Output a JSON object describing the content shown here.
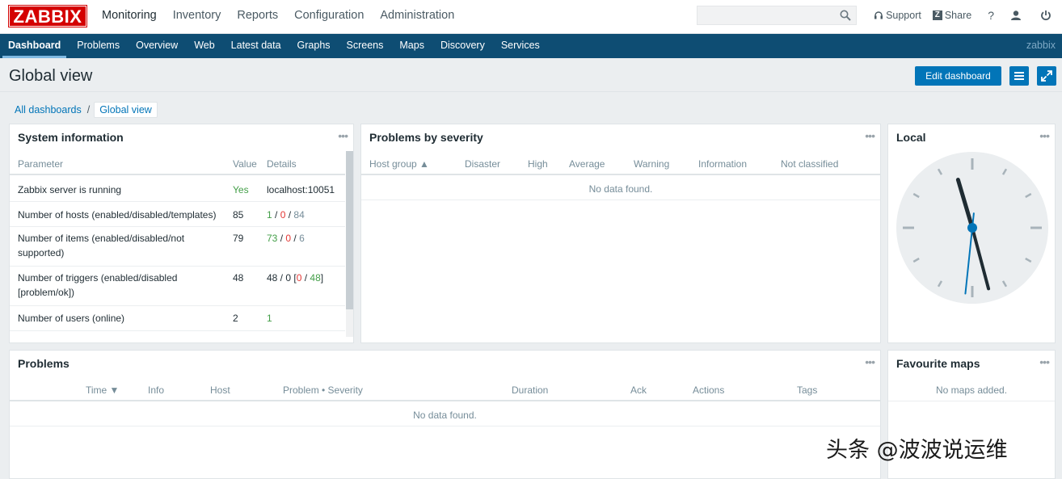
{
  "brand": {
    "logo_text": "ZABBIX",
    "accent": "#d40000",
    "nav_bg": "#0e4d73",
    "button_bg": "#0275b8"
  },
  "main_menu": [
    {
      "label": "Monitoring",
      "active": true
    },
    {
      "label": "Inventory"
    },
    {
      "label": "Reports"
    },
    {
      "label": "Configuration"
    },
    {
      "label": "Administration"
    }
  ],
  "search": {
    "value": "",
    "placeholder": "",
    "icon": "search-icon"
  },
  "top_links": {
    "support": "Support",
    "share": "Share",
    "help": "?",
    "share_icon_text": "Z"
  },
  "sub_menu": [
    {
      "label": "Dashboard",
      "active": true
    },
    {
      "label": "Problems"
    },
    {
      "label": "Overview"
    },
    {
      "label": "Web"
    },
    {
      "label": "Latest data"
    },
    {
      "label": "Graphs"
    },
    {
      "label": "Screens"
    },
    {
      "label": "Maps"
    },
    {
      "label": "Discovery"
    },
    {
      "label": "Services"
    }
  ],
  "user": "zabbix",
  "page": {
    "title": "Global view",
    "edit_button": "Edit dashboard",
    "breadcrumb": {
      "all": "All dashboards",
      "sep": "/",
      "current": "Global view"
    }
  },
  "system_info": {
    "title": "System information",
    "columns": [
      "Parameter",
      "Value",
      "Details"
    ],
    "rows": [
      {
        "param": [
          "Zabbix server is running"
        ],
        "value": "Yes",
        "details": "localhost:10051"
      },
      {
        "param": [
          "Number of hosts (enabled/disabled/templates)"
        ],
        "value": "85",
        "d1": "1",
        "d2": "0",
        "d3": "84"
      },
      {
        "param": [
          "Number of items (enabled/disabled/not",
          "supported)"
        ],
        "value": "79",
        "d1": "73",
        "d2": "0",
        "d3": "6"
      },
      {
        "param": [
          "Number of triggers (enabled/disabled",
          "[problem/ok])"
        ],
        "value": "48",
        "prefix": "48 / 0 [",
        "d2": "0",
        "d1": "48",
        "suffix": "]"
      },
      {
        "param": [
          "Number of users (online)"
        ],
        "value": "2",
        "d1": "1"
      }
    ]
  },
  "problems_by_severity": {
    "title": "Problems by severity",
    "columns": [
      "Host group ▲",
      "Disaster",
      "High",
      "Average",
      "Warning",
      "Information",
      "Not classified"
    ],
    "empty": "No data found."
  },
  "clock": {
    "title": "Local",
    "hours": 11,
    "minutes": 27,
    "seconds": 31
  },
  "problems": {
    "title": "Problems",
    "columns": [
      "Time ▼",
      "Info",
      "Host",
      "Problem • Severity",
      "Duration",
      "Ack",
      "Actions",
      "Tags"
    ],
    "empty": "No data found."
  },
  "favourite_maps": {
    "title": "Favourite maps",
    "empty": "No maps added."
  },
  "watermark": "头条 @波波说运维",
  "sep": " / "
}
